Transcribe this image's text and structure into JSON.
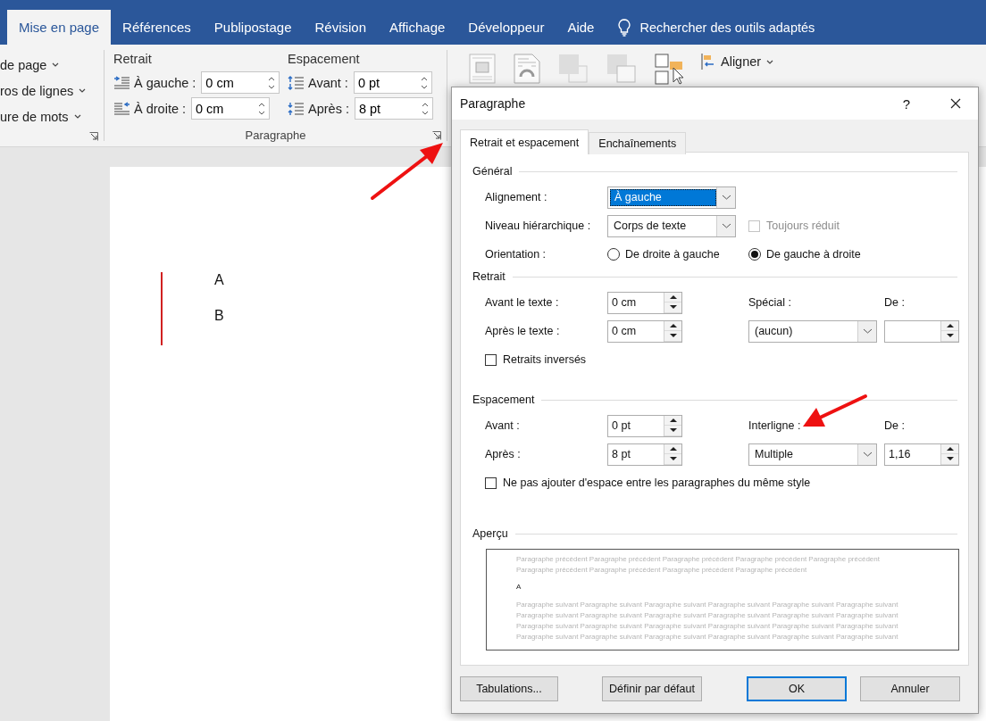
{
  "ribbon_tabs": [
    {
      "label": "Mise en page",
      "selected": true
    },
    {
      "label": "Références",
      "selected": false
    },
    {
      "label": "Publipostage",
      "selected": false
    },
    {
      "label": "Révision",
      "selected": false
    },
    {
      "label": "Affichage",
      "selected": false
    },
    {
      "label": "Développeur",
      "selected": false
    },
    {
      "label": "Aide",
      "selected": false
    }
  ],
  "tell_me": "Rechercher des outils adaptés",
  "ribbon": {
    "cut_items": [
      "de page",
      "ros de lignes",
      "ure de mots"
    ],
    "indent": {
      "title": "Retrait",
      "fields": [
        {
          "label": "À gauche :",
          "value": "0 cm"
        },
        {
          "label": "À droite :",
          "value": "0 cm"
        }
      ]
    },
    "spacing": {
      "title": "Espacement",
      "fields": [
        {
          "label": "Avant :",
          "value": "0 pt"
        },
        {
          "label": "Après :",
          "value": "8 pt"
        }
      ]
    },
    "group_label": "Paragraphe",
    "align_label": "Aligner"
  },
  "document": {
    "lines": [
      "A",
      "B"
    ]
  },
  "dialog": {
    "title": "Paragraphe",
    "help": "?",
    "tabs": [
      {
        "label": "Retrait et espacement",
        "selected": true
      },
      {
        "label": "Enchaînements",
        "selected": false
      }
    ],
    "general": {
      "title": "Général",
      "alignment": {
        "label": "Alignement :",
        "value": "À gauche",
        "focused": true
      },
      "outline": {
        "label": "Niveau hiérarchique :",
        "value": "Corps de texte",
        "focused": false
      },
      "collapsed": {
        "label": "Toujours réduit",
        "checked": false,
        "disabled": true
      },
      "orientation": {
        "label": "Orientation :",
        "options": [
          {
            "label": "De droite à gauche",
            "selected": false
          },
          {
            "label": "De gauche à droite",
            "selected": true
          }
        ]
      }
    },
    "indent": {
      "title": "Retrait",
      "before": {
        "label": "Avant le texte :",
        "value": "0 cm"
      },
      "after": {
        "label": "Après le texte :",
        "value": "0 cm"
      },
      "special": {
        "label": "Spécial :",
        "value": "(aucun)",
        "focused": false
      },
      "by": {
        "label": "De :"
      },
      "mirror": {
        "label": "Retraits inversés",
        "checked": false,
        "disabled": false
      }
    },
    "spacing": {
      "title": "Espacement",
      "before": {
        "label": "Avant :",
        "value": "0 pt"
      },
      "after": {
        "label": "Après :",
        "value": "8 pt"
      },
      "line": {
        "label": "Interligne :",
        "value": "Multiple",
        "focused": false
      },
      "at": {
        "label": "De :",
        "value": "1,16"
      },
      "no_space": {
        "label": "Ne pas ajouter d'espace entre les paragraphes du même style",
        "checked": false,
        "disabled": false
      }
    },
    "preview": {
      "title": "Aperçu",
      "previous": [
        "Paragraphe précédent Paragraphe précédent Paragraphe précédent Paragraphe précédent Paragraphe précédent",
        "Paragraphe précédent Paragraphe précédent Paragraphe précédent Paragraphe précédent"
      ],
      "current": "A",
      "next": [
        "Paragraphe suivant Paragraphe suivant Paragraphe suivant Paragraphe suivant Paragraphe suivant Paragraphe suivant",
        "Paragraphe suivant Paragraphe suivant Paragraphe suivant Paragraphe suivant Paragraphe suivant Paragraphe suivant",
        "Paragraphe suivant Paragraphe suivant Paragraphe suivant Paragraphe suivant Paragraphe suivant Paragraphe suivant",
        "Paragraphe suivant Paragraphe suivant Paragraphe suivant Paragraphe suivant Paragraphe suivant Paragraphe suivant"
      ]
    },
    "buttons": [
      {
        "label": "Tabulations...",
        "default": false
      },
      {
        "label": "Définir par défaut",
        "default": false
      },
      {
        "label": "OK",
        "default": true
      },
      {
        "label": "Annuler",
        "default": false
      }
    ]
  }
}
